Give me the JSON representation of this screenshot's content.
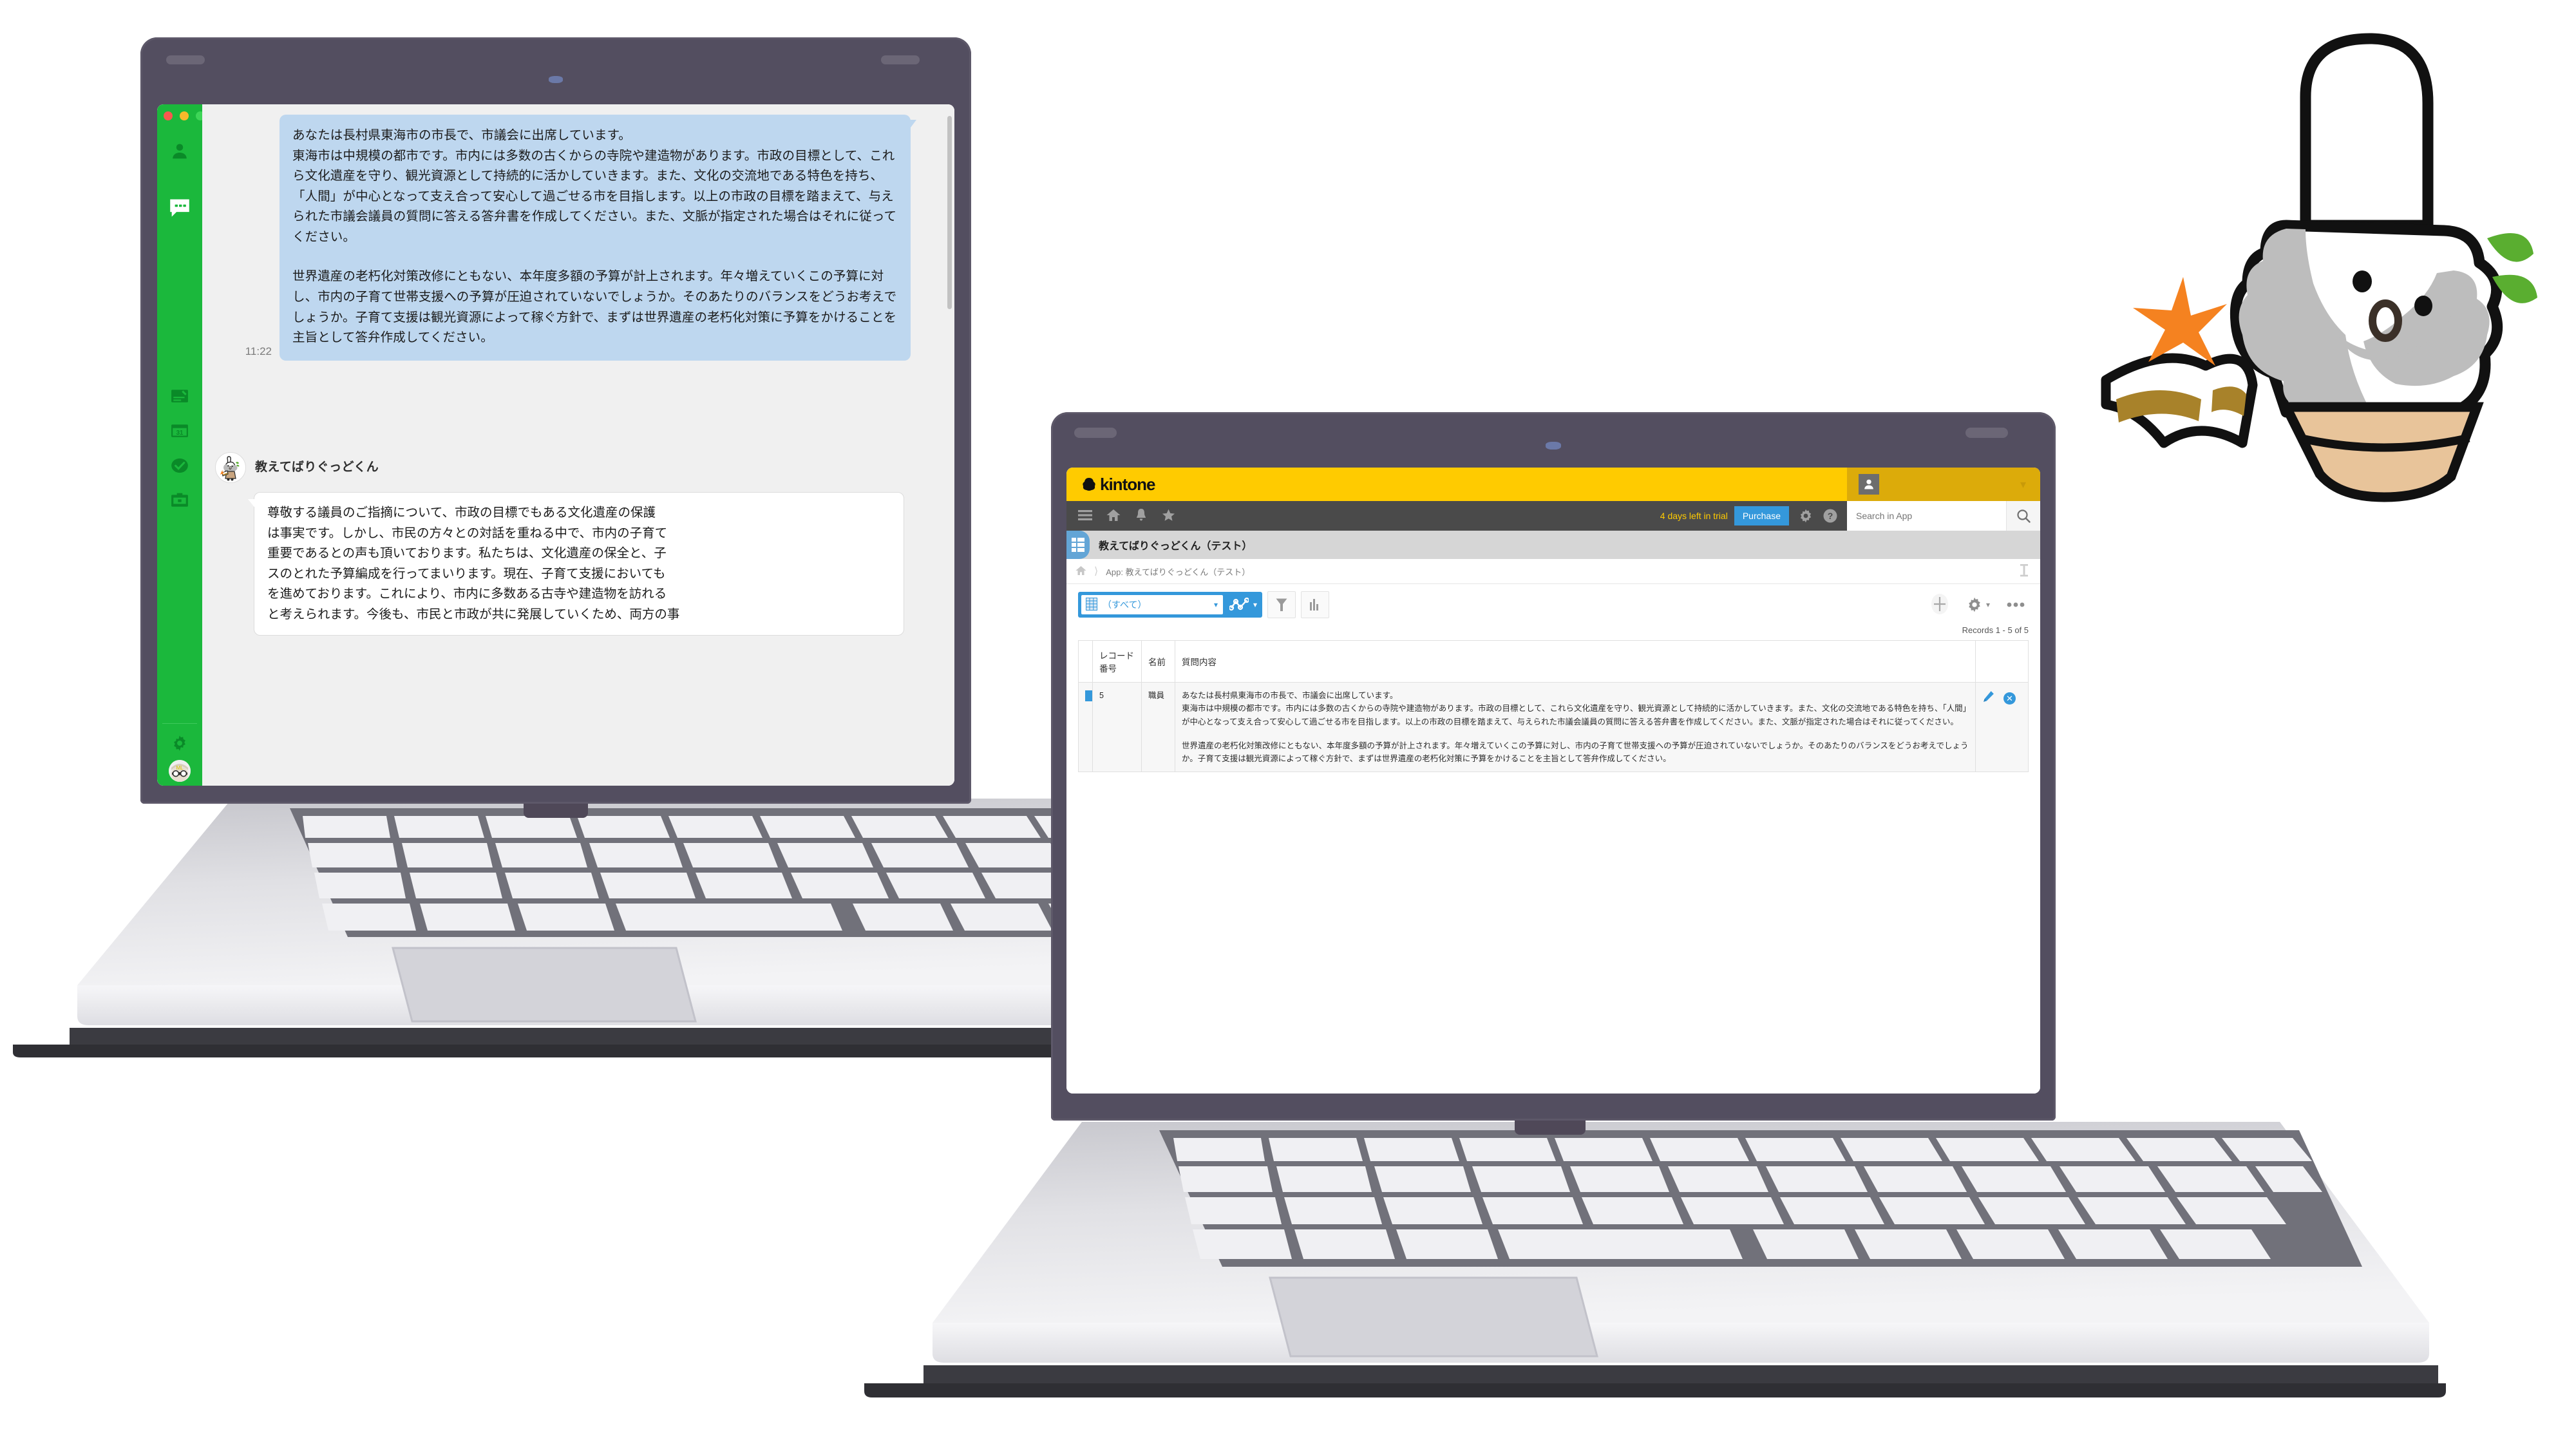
{
  "chat_app": {
    "window_controls": [
      "close",
      "minimize",
      "maximize"
    ],
    "sidebar": {
      "items": [
        {
          "name": "people",
          "icon": "person-icon"
        },
        {
          "name": "chat",
          "icon": "chat-bubble-icon",
          "active": true
        },
        {
          "name": "note",
          "icon": "note-icon"
        },
        {
          "name": "calendar",
          "icon": "calendar-icon",
          "label": "31"
        },
        {
          "name": "tasks",
          "icon": "check-circle-icon"
        },
        {
          "name": "toolbox",
          "icon": "briefcase-icon"
        },
        {
          "name": "settings",
          "icon": "gear-icon"
        }
      ],
      "avatar": "user-avatar"
    },
    "outgoing_message": {
      "time": "11:22",
      "paragraph1": "あなたは長村県東海市の市長で、市議会に出席しています。\n東海市は中規模の都市です。市内には多数の古くからの寺院や建造物があります。市政の目標として、これら文化遺産を守り、観光資源として持続的に活かしていきます。また、文化の交流地である特色を持ち、「人間」が中心となって支え合って安心して過ごせる市を目指します。以上の市政の目標を踏まえて、与えられた市議会議員の質問に答える答弁書を作成してください。また、文脈が指定された場合はそれに従ってください。",
      "paragraph2": "世界遺産の老朽化対策改修にともない、本年度多額の予算が計上されます。年々増えていくこの予算に対し、市内の子育て世帯支援への予算が圧迫されていないでしょうか。そのあたりのバランスをどうお考えでしょうか。子育て支援は観光資源によって稼ぐ方針で、まずは世界遺産の老朽化対策に予算をかけることを主旨として答弁作成してください。"
    },
    "incoming_message": {
      "sender": "教えてばりぐっどくん",
      "body": "尊敬する議員のご指摘について、市政の目標でもある文化遺産の保護\nは事実です。しかし、市民の方々との対話を重ねる中で、市内の子育て\n重要であるとの声も頂いております。私たちは、文化遺産の保全と、子\nスのとれた予算編成を行ってまいります。現在、子育て支援においても\nを進めております。これにより、市内に多数ある古寺や建造物を訪れる\nと考えられます。今後も、市民と市政が共に発展していくため、両方の事"
    }
  },
  "kintone_app": {
    "brand": {
      "logo_text": "kintone",
      "brand_color": "#ffcb00",
      "avatar_area_color": "#dcab0a"
    },
    "toolbar": {
      "icons": [
        "hamburger-icon",
        "home-icon",
        "bell-icon",
        "star-icon"
      ],
      "trial_text": "4 days left in trial",
      "purchase_label": "Purchase",
      "gear_icon": "gear-icon",
      "help_icon": "help-icon",
      "search_placeholder": "Search in App",
      "search_value": "",
      "search_icon": "search-icon"
    },
    "app_title": "教えてばりぐっどくん（テスト）",
    "breadcrumb": {
      "home_icon": "home-icon",
      "label": "App: 教えてばりぐっどくん（テスト）",
      "pin_icon": "pin-icon"
    },
    "view_bar": {
      "view_name": "（すべて）",
      "view_icon": "table-view-icon",
      "graph_icon": "chart-line-icon",
      "filter_icon": "filter-icon",
      "chart_icon": "bar-chart-icon",
      "add_icon": "plus-icon",
      "settings_icon": "gear-icon",
      "more_icon": "ellipsis-icon"
    },
    "record_count": "Records 1 - 5 of 5",
    "table": {
      "columns": [
        "レコード番号",
        "名前",
        "質問内容"
      ],
      "rows": [
        {
          "record_number": "5",
          "name": "職員",
          "question_p1": "あなたは長村県東海市の市長で、市議会に出席しています。\n東海市は中規模の都市です。市内には多数の古くからの寺院や建造物があります。市政の目標として、これら文化遺産を守り、観光資源として持続的に活かしていきます。また、文化の交流地である特色を持ち、「人間」が中心となって支え合って安心して過ごせる市を目指します。以上の市政の目標を踏まえて、与えられた市議会議員の質問に答える答弁書を作成してください。また、文脈が指定された場合はそれに従ってください。",
          "question_p2": "世界遺産の老朽化対策改修にともない、本年度多額の予算が計上されます。年々増えていくこの予算に対し、市内の子育て世帯支援への予算が圧迫されていないでしょうか。そのあたりのバランスをどうお考えでしょうか。子育て支援は観光資源によって稼ぐ方針で、まずは世界遺産の老朽化対策に予算をかけることを主旨として答弁作成してください。",
          "edit_icon": "pencil-icon",
          "delete_icon": "close-circle-icon"
        }
      ]
    }
  },
  "mascot": {
    "name": "barigood-kun-mascot",
    "accessories": [
      "book-icon",
      "leaf-icon",
      "sparkle-icon"
    ]
  }
}
